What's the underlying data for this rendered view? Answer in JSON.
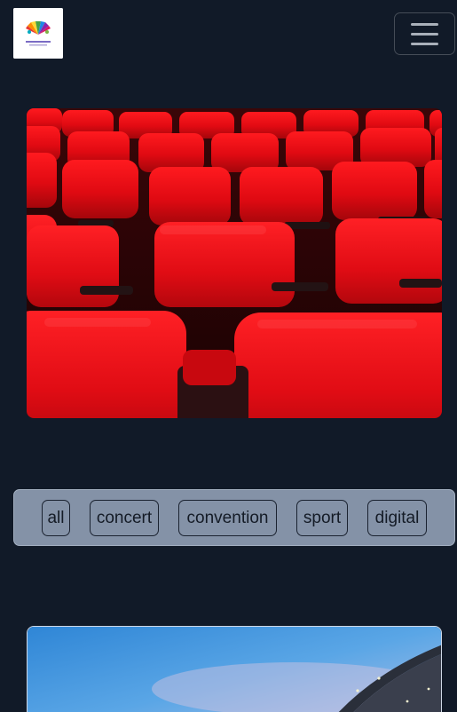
{
  "header": {
    "logo_icon": "colorful-fan-logo",
    "menu_icon": "hamburger-menu-icon"
  },
  "hero": {
    "image_subject": "rows of red theater seats"
  },
  "filters": {
    "items": [
      "all",
      "concert",
      "convention",
      "sport",
      "digital"
    ]
  },
  "venue": {
    "image_subject": "modern arena building at dusk"
  },
  "colors": {
    "page_background": "#111a28",
    "filter_bar": "#8492a7",
    "seat_red": "#e00a12"
  }
}
